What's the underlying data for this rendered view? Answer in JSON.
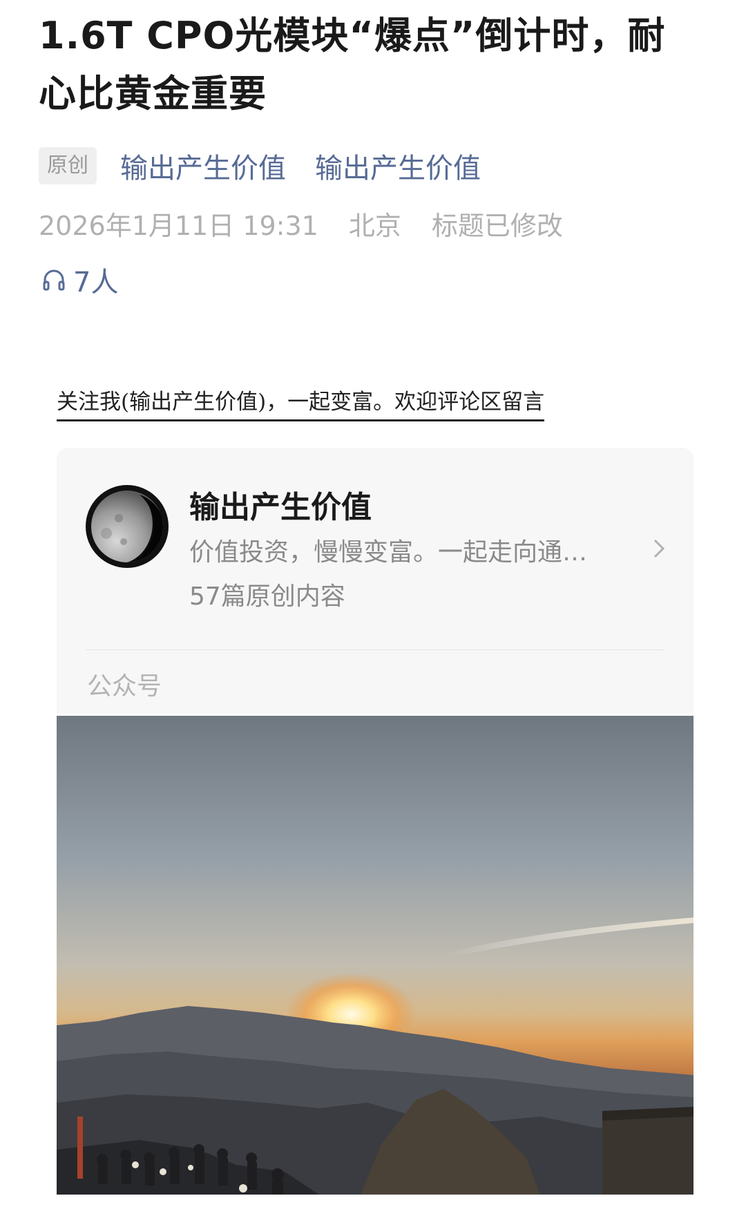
{
  "article": {
    "title": "1.6T CPO光模块“爆点”倒计时，耐心比黄金重要",
    "original_tag": "原创",
    "author_links": [
      "输出产生价值",
      "输出产生价值"
    ],
    "date": "2026年1月11日 19:31",
    "location": "北京",
    "edit_note": "标题已修改",
    "listeners": "7人",
    "icon": "headphones-icon"
  },
  "body": {
    "follow_text": "关注我(输出产生价值)，一起变富。欢迎评论区留言"
  },
  "account_card": {
    "name": "输出产生价值",
    "description": "价值投资，慢慢变富。一起走向通…",
    "count": "57篇原创内容",
    "footer": "公众号",
    "avatar_icon": "moon-avatar",
    "chevron_icon": "chevron-right-icon"
  },
  "colors": {
    "link": "#576b95",
    "muted": "#b0b0b0",
    "card_bg": "#f7f7f7"
  }
}
